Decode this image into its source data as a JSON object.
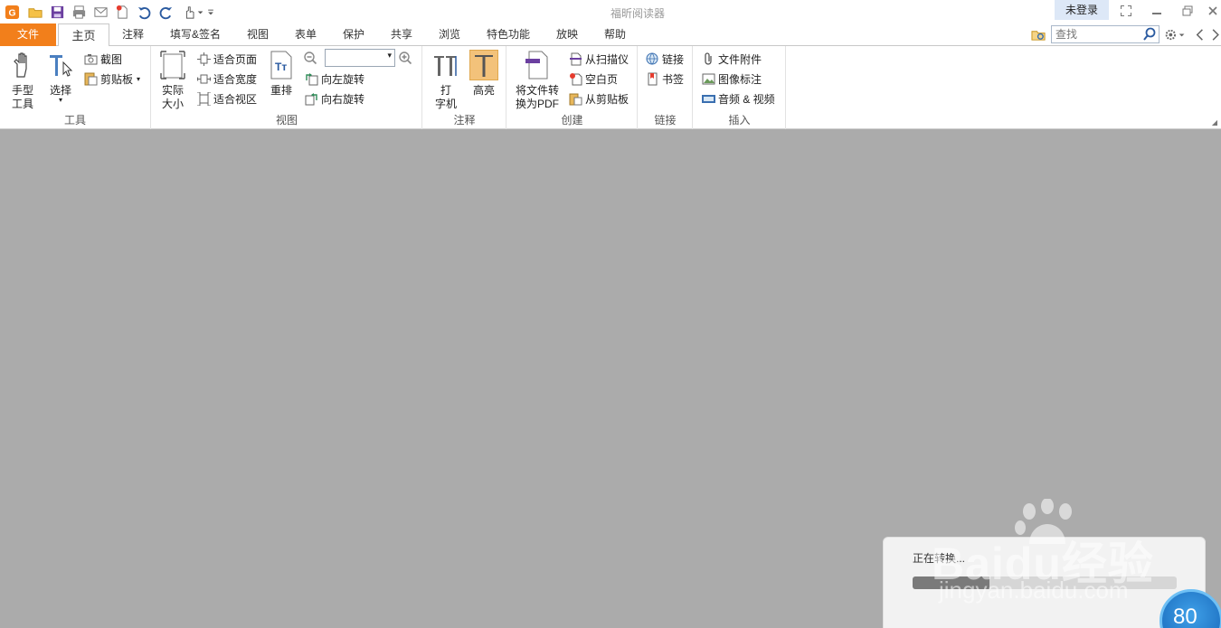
{
  "window": {
    "title": "福昕阅读器",
    "login": "未登录"
  },
  "quick_access": [
    "logo-icon",
    "open-icon",
    "save-icon",
    "print-icon",
    "email-icon",
    "new-icon",
    "undo-icon",
    "redo-icon",
    "hand-icon"
  ],
  "tabs": [
    {
      "label": "文件",
      "active": false
    },
    {
      "label": "主页",
      "active": true
    },
    {
      "label": "注释",
      "active": false
    },
    {
      "label": "填写&签名",
      "active": false
    },
    {
      "label": "视图",
      "active": false
    },
    {
      "label": "表单",
      "active": false
    },
    {
      "label": "保护",
      "active": false
    },
    {
      "label": "共享",
      "active": false
    },
    {
      "label": "浏览",
      "active": false
    },
    {
      "label": "特色功能",
      "active": false
    },
    {
      "label": "放映",
      "active": false
    },
    {
      "label": "帮助",
      "active": false
    }
  ],
  "search": {
    "placeholder": "查找"
  },
  "ribbon": {
    "tools": {
      "label": "工具",
      "hand_line1": "手型",
      "hand_line2": "工具",
      "select": "选择",
      "snapshot": "截图",
      "clipboard": "剪贴板"
    },
    "view": {
      "label": "视图",
      "actual_line1": "实际",
      "actual_line2": "大小",
      "fit_page": "适合页面",
      "fit_width": "适合宽度",
      "fit_visible": "适合视区",
      "reflow": "重排",
      "zoom_value": "",
      "rotate_left": "向左旋转",
      "rotate_right": "向右旋转"
    },
    "comment": {
      "label": "注释",
      "typewriter_line1": "打",
      "typewriter_line2": "字机",
      "highlight": "高亮"
    },
    "create": {
      "label": "创建",
      "convert_line1": "将文件转",
      "convert_line2": "换为PDF",
      "from_scanner": "从扫描仪",
      "blank_page": "空白页",
      "from_clipboard": "从剪贴板"
    },
    "links": {
      "label": "链接",
      "link": "链接",
      "bookmark": "书签"
    },
    "insert": {
      "label": "插入",
      "attachment": "文件附件",
      "image": "图像标注",
      "av": "音频 & 视频"
    }
  },
  "conversion": {
    "status": "正在转换...",
    "progress": 0.29
  },
  "watermark": {
    "logo": "Baidu经验",
    "url": "jingyan.baidu.com"
  },
  "speed_widget": {
    "value": "80"
  },
  "colors": {
    "accent": "#f27f1b",
    "workspace": "#ababab",
    "highlight_active": "#f3c27a"
  }
}
